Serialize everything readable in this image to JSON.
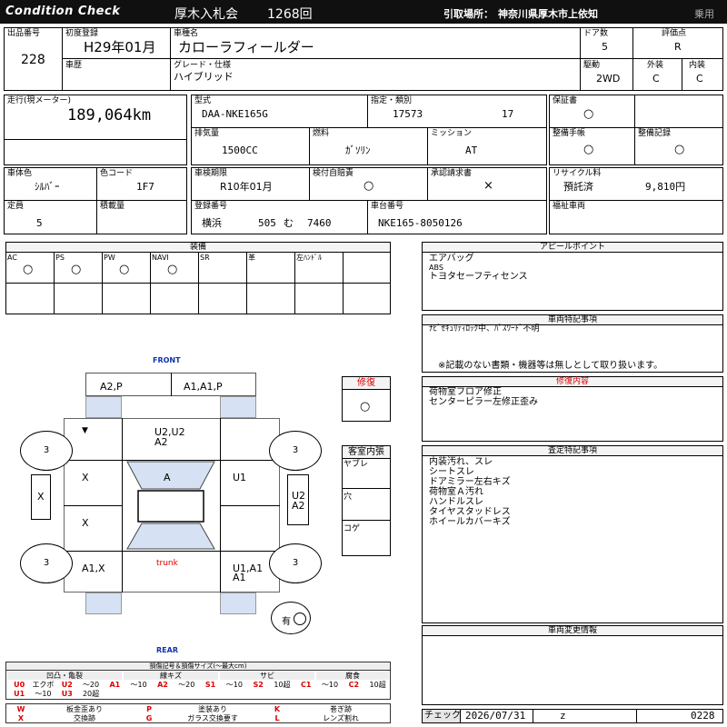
{
  "header": {
    "logo": "Condition  Check",
    "auction": "厚木入札会",
    "session": "1268回",
    "pickup_label": "引取場所：",
    "pickup_place": "神奈川県厚木市上依知",
    "category": "乗用"
  },
  "top": {
    "lot_label": "出品番号",
    "lot": "228",
    "first_reg_label": "初度登録",
    "first_reg": "H29年01月",
    "car_name_label": "車種名",
    "car_name": "カローラフィールダー",
    "doors_label": "ドア数",
    "doors": "5",
    "score_label": "評価点",
    "score": "R",
    "history_label": "車歴",
    "grade_label": "グレード・仕様",
    "grade": "ハイブリッド",
    "drive_label": "駆動",
    "drive": "2WD",
    "exterior_label": "外装",
    "exterior": "C",
    "interior_label": "内装",
    "interior": "C"
  },
  "spec": {
    "mileage_label": "走行(現メーター)",
    "mileage": "189,064km",
    "model_label": "型式",
    "model": "DAA-NKE165G",
    "designation_label": "指定・類別",
    "designation": "17573",
    "class": "17",
    "warranty_label": "保証書",
    "warranty": "○",
    "displacement_label": "排気量",
    "displacement": "1500CC",
    "fuel_label": "燃料",
    "fuel": "ｶﾞｿﾘﾝ",
    "mission_label": "ミッション",
    "mission": "AT",
    "maintenance_label": "整備手帳",
    "maintenance": "○",
    "record_label": "整備記録",
    "record": "○",
    "color_label": "車体色",
    "color": "ｼﾙﾊﾞｰ",
    "color_code_label": "色コード",
    "color_code": "1F7",
    "inspection_label": "車検期限",
    "inspection": "R10年01月",
    "insurance_label": "検付自賠責",
    "insurance": "○",
    "approval_label": "承認請求書",
    "approval": "×",
    "recycle_label": "リサイクル料",
    "recycle_status": "預託済",
    "recycle_fee": "9,810円",
    "capacity_label": "定員",
    "capacity": "5",
    "load_label": "積載量",
    "plate_label": "登録番号",
    "plate_area": "横浜",
    "plate_class": "505",
    "plate_kana": "む",
    "plate_no": "7460",
    "chassis_label": "車台番号",
    "chassis": "NKE165-8050126",
    "welfare_label": "福祉車両"
  },
  "equipment": {
    "title": "装備",
    "items": [
      {
        "label": "AC",
        "value": "○"
      },
      {
        "label": "PS",
        "value": "○"
      },
      {
        "label": "PW",
        "value": "○"
      },
      {
        "label": "NAVI",
        "value": "○"
      },
      {
        "label": "SR",
        "value": ""
      },
      {
        "label": "革",
        "value": ""
      },
      {
        "label": "左ﾊﾝﾄﾞﾙ",
        "value": ""
      }
    ]
  },
  "appeal": {
    "title": "アピールポイント",
    "lines": [
      "エアバッグ",
      "ABS",
      "トヨタセーフティセンス"
    ]
  },
  "notes": {
    "title": "車両特記事項",
    "line1": "ﾅﾋﾞｾｷｭﾘﾃｨﾛｯｸ中、ﾊﾟｽﾜｰﾄﾞ不明",
    "line2": "※記載のない書類・機器等は無しとして取り扱います。"
  },
  "repair_detail": {
    "title": "修復内容",
    "lines": [
      "荷物室フロア修正",
      "センターピラー左修正歪み"
    ]
  },
  "inspection_notes": {
    "title": "査定特記事項",
    "lines": [
      "内装汚れ、スレ",
      "シートスレ",
      "ドアミラー左右キズ",
      "荷物室Ａ汚れ",
      "ハンドルスレ",
      "タイヤスタッドレス",
      "ホイールカバーキズ"
    ]
  },
  "change_info": {
    "title": "車両変更情報"
  },
  "check": {
    "label": "チェック",
    "date": "2026/07/31",
    "z": "z",
    "number": "0228"
  },
  "repair_box": {
    "title": "修復",
    "value": "○"
  },
  "cabin": {
    "title": "客室内張",
    "items": [
      "ヤブレ",
      "穴",
      "コゲ"
    ]
  },
  "diagram": {
    "front": "FRONT",
    "rear": "REAR",
    "trunk": "trunk",
    "front_left": "A2,P",
    "front_right": "A1,A1,P",
    "hood_1": "U2,U2",
    "hood_2": "A2",
    "left_a": "X",
    "left_b": "X",
    "left_c": "X",
    "roof": "A",
    "right_door": "U1",
    "right_side_1": "U2",
    "right_side_2": "A2",
    "rear_left": "A1,X",
    "rear_right_1": "U1,A1",
    "rear_right_2": "A1",
    "tire_fl": "3",
    "tire_fr": "3",
    "tire_rl": "3",
    "tire_rr": "3",
    "spare_label": "有",
    "wiper_icon": "▼"
  },
  "legend": {
    "title": "損傷記号＆損傷サイズ(〜最大cm)",
    "groups": [
      "凹凸・亀裂",
      "線キズ",
      "サビ",
      "腐食"
    ],
    "row1": [
      "U0",
      "エクボ",
      "U2",
      "〜20",
      "A1",
      "〜10",
      "A2",
      "〜20",
      "S1",
      "〜10",
      "S2",
      "10超",
      "C1",
      "〜10",
      "C2",
      "10超"
    ],
    "row2": [
      "U1",
      "〜10",
      "U3",
      "20超",
      "",
      "",
      "",
      "",
      "",
      "",
      "",
      "",
      "",
      "",
      "",
      ""
    ],
    "codes": [
      {
        "k": "W",
        "v": "板金歪あり"
      },
      {
        "k": "P",
        "v": "塗装あり"
      },
      {
        "k": "K",
        "v": "巻ぎ跡"
      },
      {
        "k": "X",
        "v": "交換跡"
      },
      {
        "k": "G",
        "v": "ガラス交換要す"
      },
      {
        "k": "L",
        "v": "レンズ割れ"
      }
    ]
  },
  "colors": {
    "header_bg": "#101010",
    "panel_blue": "#d6e2f3",
    "accent_red": "#dd0000",
    "link_blue": "#1133aa"
  }
}
